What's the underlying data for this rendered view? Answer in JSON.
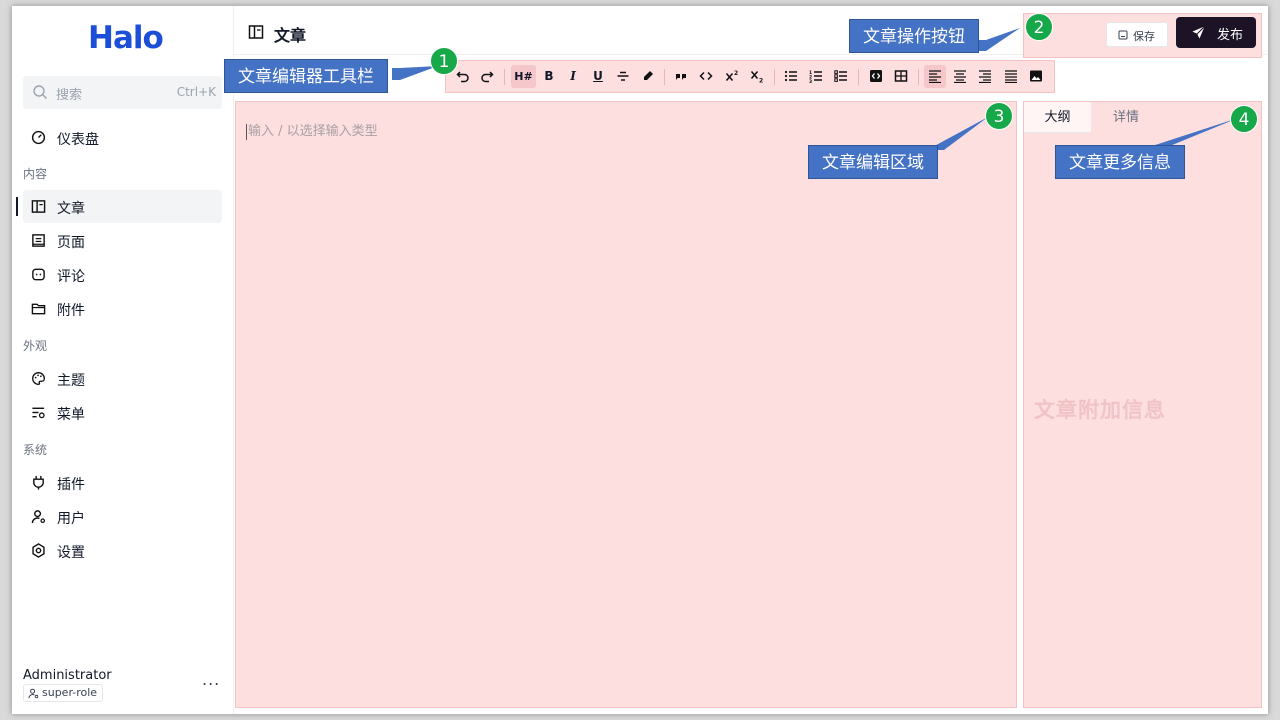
{
  "sidebar": {
    "logo": "Halo",
    "search": {
      "label": "搜索",
      "shortcut": "Ctrl+K"
    },
    "items": [
      {
        "label": "仪表盘",
        "icon": "dashboard-icon"
      },
      {
        "label": "文章",
        "icon": "article-icon",
        "active": true
      },
      {
        "label": "页面",
        "icon": "page-icon"
      },
      {
        "label": "评论",
        "icon": "comment-icon"
      },
      {
        "label": "附件",
        "icon": "folder-icon"
      },
      {
        "label": "主题",
        "icon": "palette-icon"
      },
      {
        "label": "菜单",
        "icon": "menu-icon"
      },
      {
        "label": "插件",
        "icon": "plugin-icon"
      },
      {
        "label": "用户",
        "icon": "user-icon"
      },
      {
        "label": "设置",
        "icon": "settings-icon"
      }
    ],
    "groups": [
      "内容",
      "外观",
      "系统"
    ],
    "user": {
      "name": "Administrator",
      "role": "super-role",
      "more": "..."
    }
  },
  "header": {
    "title": "文章",
    "save_label": "保存",
    "publish_label": "发布"
  },
  "toolbar": {
    "heading_label": "H#",
    "bold_label": "B",
    "italic_label": "I",
    "underline_label": "U"
  },
  "editor": {
    "placeholder": "输入 / 以选择输入类型"
  },
  "panel": {
    "tabs": [
      "大纲",
      "详情"
    ],
    "watermark": "文章附加信息"
  },
  "callouts": [
    {
      "number": "1",
      "text": "文章编辑器工具栏"
    },
    {
      "number": "2",
      "text": "文章操作按钮"
    },
    {
      "number": "3",
      "text": "文章编辑区域"
    },
    {
      "number": "4",
      "text": "文章更多信息"
    }
  ],
  "colors": {
    "brand": "#1d4ed8",
    "highlight_fill": "#fddfe0",
    "callout_blue": "#4472c4",
    "badge_green": "#17a84a",
    "publish_button": "#1c1426"
  }
}
